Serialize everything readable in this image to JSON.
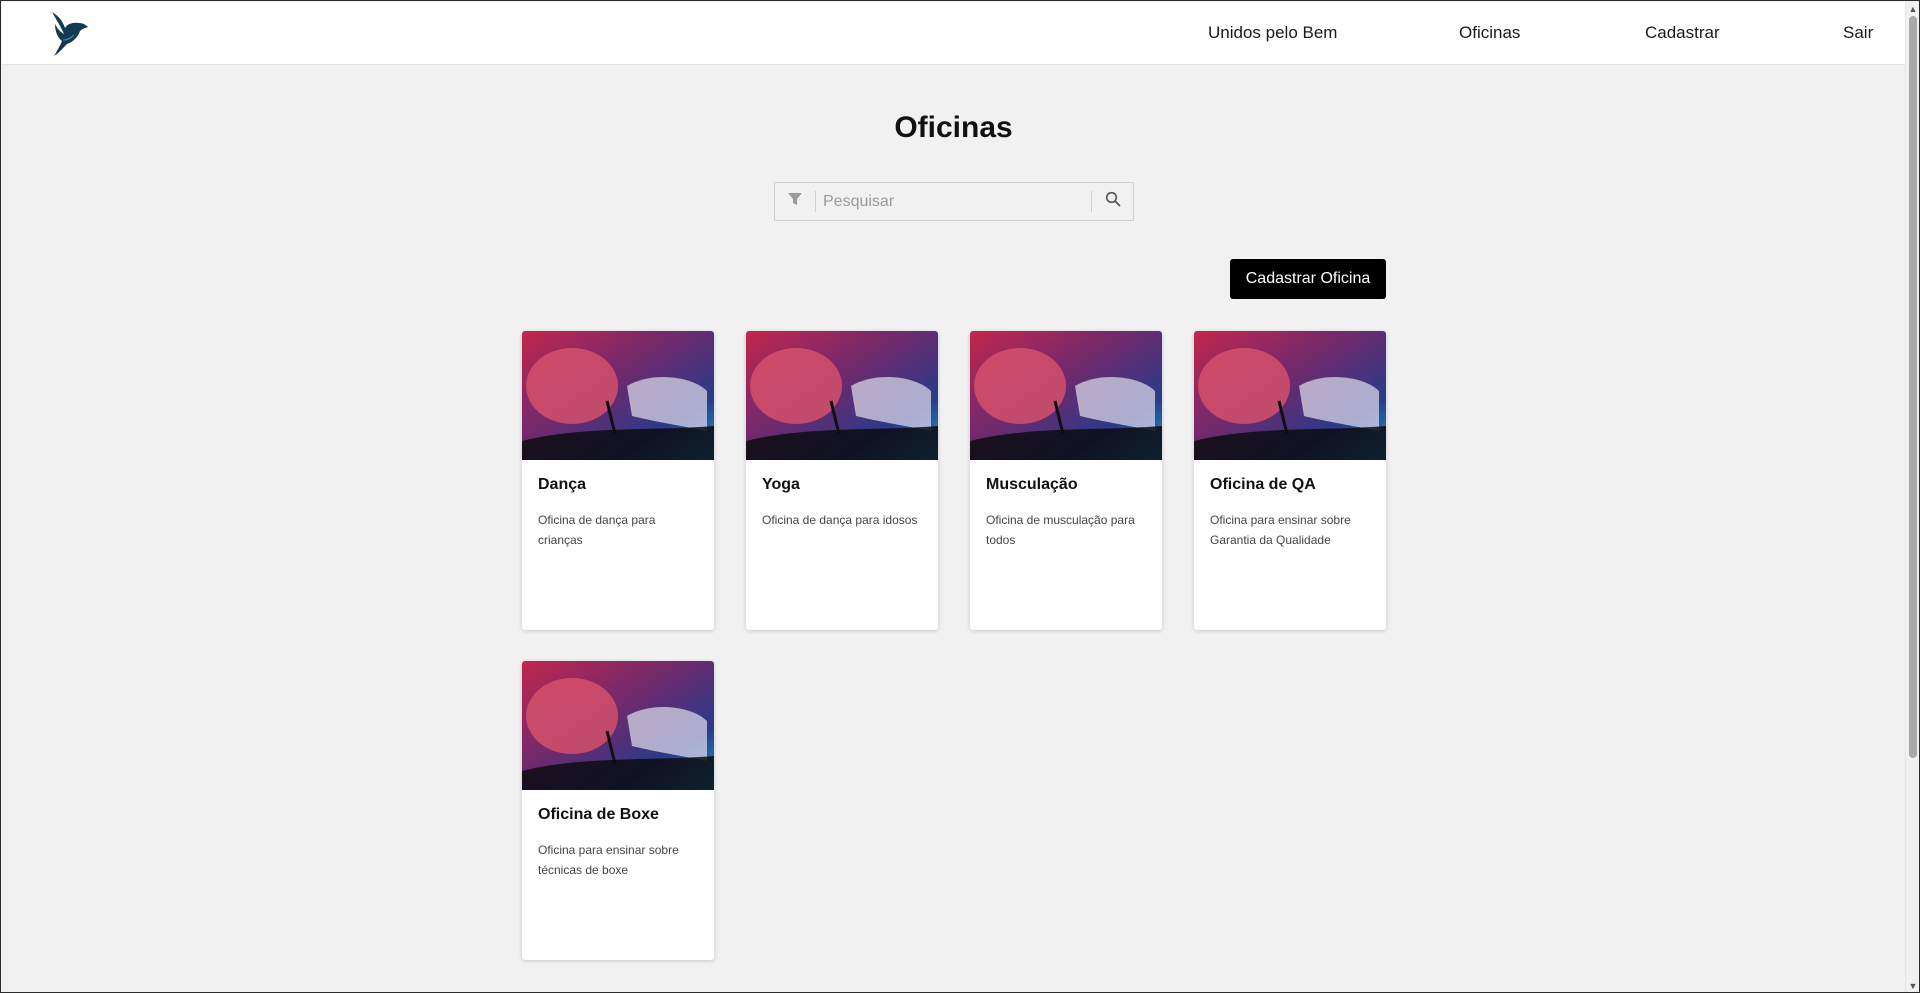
{
  "header": {
    "logo_icon": "dove-logo-icon",
    "nav": [
      {
        "label": "Unidos pelo Bem"
      },
      {
        "label": "Oficinas"
      },
      {
        "label": "Cadastrar"
      },
      {
        "label": "Sair"
      }
    ]
  },
  "main": {
    "title": "Oficinas",
    "search": {
      "placeholder": "Pesquisar",
      "value": "",
      "filter_icon": "filter-icon",
      "search_icon": "search-icon"
    },
    "register_button_label": "Cadastrar Oficina",
    "cards": [
      {
        "title": "Dança",
        "description": "Oficina de dança para crianças"
      },
      {
        "title": "Yoga",
        "description": "Oficina de dança para idosos"
      },
      {
        "title": "Musculação",
        "description": "Oficina de musculação para todos"
      },
      {
        "title": "Oficina de QA",
        "description": "Oficina para ensinar sobre Garantia da Qualidade"
      },
      {
        "title": "Oficina de Boxe",
        "description": "Oficina para ensinar sobre técnicas de boxe"
      }
    ]
  },
  "colors": {
    "page_background": "#f1f1f1",
    "header_background": "#ffffff",
    "button_background": "#000000",
    "logo_color": "#123a52"
  }
}
